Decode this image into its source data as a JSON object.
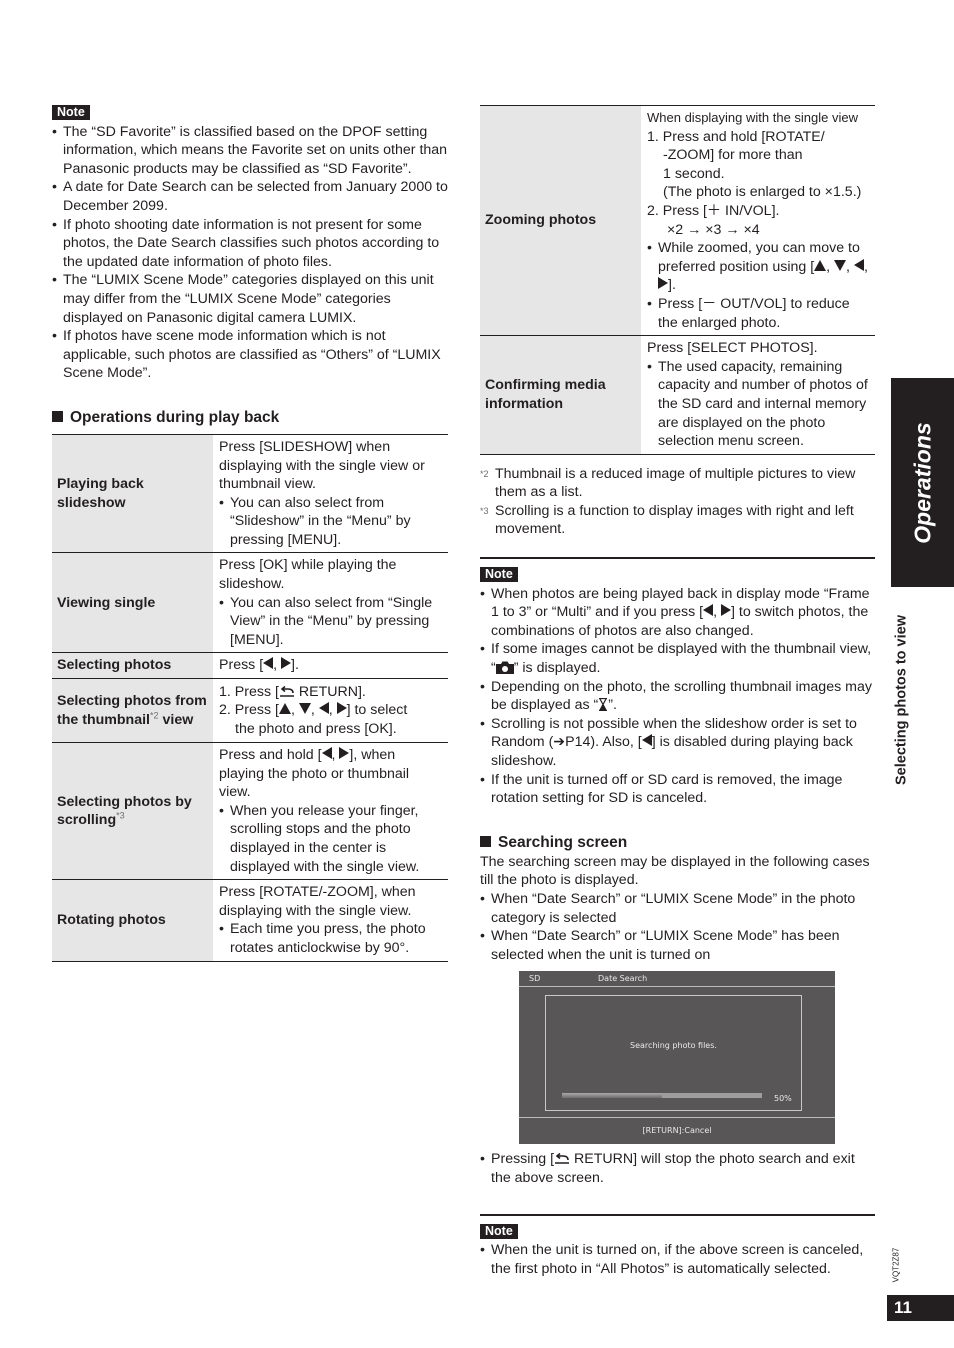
{
  "left": {
    "note1": {
      "tag": "Note",
      "items": [
        "The “SD Favorite” is classified based on the DPOF setting information, which means the Favorite set on units other than Panasonic products may be classified as “SD Favorite”.",
        "A date for Date Search can be selected from January 2000 to December 2099.",
        "If photo shooting date information is not present for some photos, the Date Search classifies such photos according to the updated date information of photo files.",
        "The “LUMIX Scene Mode” categories displayed on this unit may differ from the “LUMIX Scene Mode” categories displayed on Panasonic digital camera LUMIX.",
        "If photos have scene mode information which is not applicable, such photos are classified as “Others” of “LUMIX Scene Mode”."
      ]
    },
    "ops_heading": "Operations during play back",
    "ops": {
      "playing": {
        "label": "Playing back slideshow",
        "line": "Press [SLIDESHOW] when displaying with the single view or thumbnail view.",
        "bullet": "You can also select from “Slideshow” in the “Menu” by pressing [MENU]."
      },
      "viewing": {
        "label": "Viewing single",
        "line": "Press [OK] while playing the slideshow.",
        "bullet": "You can also select from “Single View” in the “Menu” by pressing [MENU]."
      },
      "selecting": {
        "label": "Selecting photos",
        "pre": "Press [",
        "post": "]."
      },
      "thumbnail": {
        "label": "Selecting photos from the thumbnail",
        "label_sup": "*2",
        "label_end": "view",
        "step1_pre": "1. Press [",
        "step1_post": " RETURN].",
        "step2_pre": "2. Press [",
        "step2_post": "] to select",
        "step2_cont": "the photo and press [OK]."
      },
      "scrolling": {
        "label": "Selecting photos by scrolling",
        "label_sup": "*3",
        "line_pre": "Press and hold [",
        "line_post": "], when playing the photo or thumbnail view.",
        "bullet": "When you release your finger, scrolling stops and the photo displayed in the center is displayed with the single view."
      },
      "rotating": {
        "label": "Rotating photos",
        "line": "Press [ROTATE/-ZOOM], when displaying with the single view.",
        "bullet": "Each time you press, the photo rotates anticlockwise by 90°."
      }
    }
  },
  "right": {
    "zoom": {
      "label": "Zooming photos",
      "intro": "When displaying with the single view",
      "step1": "1. Press and hold [ROTATE/",
      "step1_cont": [
        "-ZOOM] for more than",
        "1 second.",
        "(The photo is enlarged to ×1.5.)"
      ],
      "step2": "2. Press [＋ IN/VOL].",
      "step2_cont": "×2 → ×3 → ×4",
      "bullet1_pre": "While zoomed, you can move to preferred position using [",
      "bullet1_post": "].",
      "bullet2": "Press [－ OUT/VOL] to reduce the enlarged photo."
    },
    "media": {
      "label": "Confirming media information",
      "line": "Press [SELECT PHOTOS].",
      "bullet": "The used capacity, remaining capacity and number of photos of the SD card and internal memory are displayed on the photo selection menu screen."
    },
    "footnotes": [
      {
        "mark": "*2",
        "text": "Thumbnail is a reduced image of multiple pictures to view them as a list."
      },
      {
        "mark": "*3",
        "text": "Scrolling is a function to display images with right and left movement."
      }
    ],
    "note2": {
      "tag": "Note",
      "item1_pre": "When photos are being played back in display mode “Frame 1 to 3” or “Multi” and if you press [",
      "item1_post": "] to switch photos, the combinations of photos are also changed.",
      "item2_pre": "If some images cannot be displayed with the thumbnail view, “",
      "item2_post": "” is displayed.",
      "item3_pre": "Depending on the photo, the scrolling thumbnail images may be displayed as “",
      "item3_post": "”.",
      "item4_pre": "Scrolling is not possible when the slideshow order is set to Random (➔P14). Also, [",
      "item4_post": "] is disabled during playing back slideshow.",
      "item5": "If the unit is turned off or SD card is removed, the image rotation setting for SD is canceled."
    },
    "search_heading": "Searching screen",
    "search_intro": "The searching screen may be displayed in the following cases till the photo is displayed.",
    "search_items": [
      "When “Date Search” or “LUMIX Scene Mode” in the photo category is selected",
      "When “Date Search” or “LUMIX Scene Mode” has been selected when the unit is turned on"
    ],
    "screen": {
      "media": "SD",
      "title": "Date Search",
      "message": "Searching  photo  files.",
      "progress_percent": 50,
      "progress_label": "50%",
      "footer": "[RETURN]:Cancel"
    },
    "return_pre": "Pressing [",
    "return_post": " RETURN] will stop the photo search and exit the above screen.",
    "note3": {
      "tag": "Note",
      "items": [
        "When the unit is turned on, if the above screen is canceled, the first photo in “All Photos” is automatically selected."
      ]
    }
  },
  "side": {
    "tab": "Operations",
    "subtitle": "Selecting photos to view",
    "model": "VQT2Z87",
    "page": "11"
  }
}
